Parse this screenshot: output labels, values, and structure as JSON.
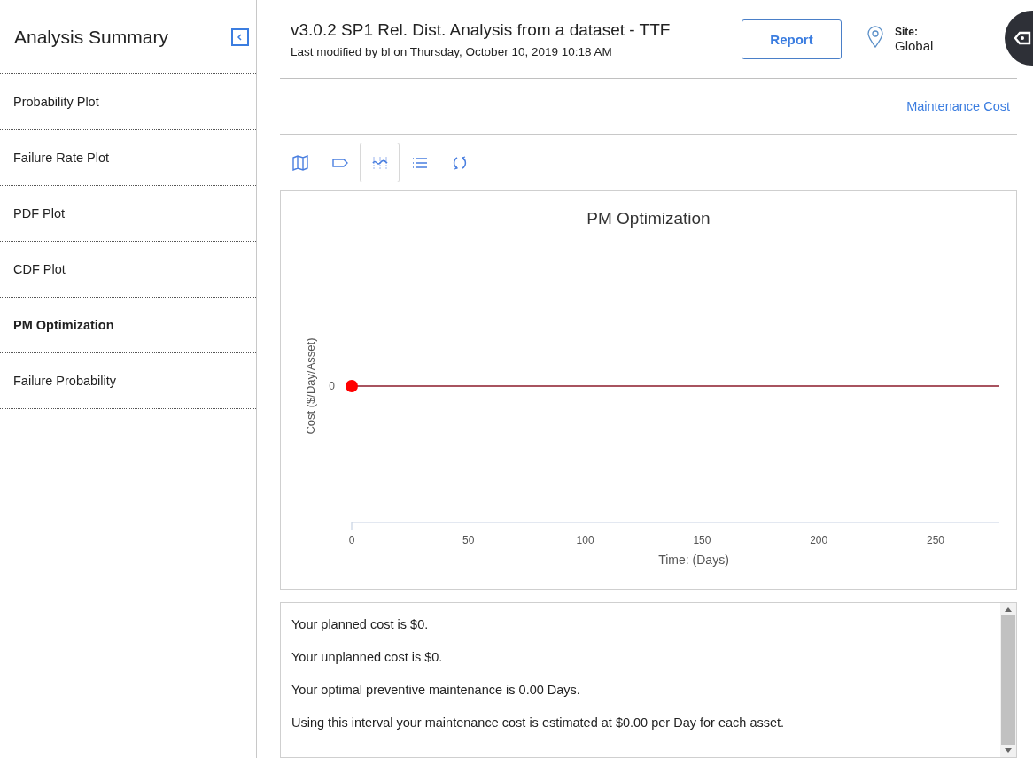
{
  "sidebar": {
    "title": "Analysis Summary",
    "items": [
      {
        "label": "Probability Plot",
        "selected": false
      },
      {
        "label": "Failure Rate Plot",
        "selected": false
      },
      {
        "label": "PDF Plot",
        "selected": false
      },
      {
        "label": "CDF Plot",
        "selected": false
      },
      {
        "label": "PM Optimization",
        "selected": true
      },
      {
        "label": "Failure Probability",
        "selected": false
      }
    ]
  },
  "header": {
    "title": "v3.0.2 SP1 Rel. Dist. Analysis from a dataset - TTF",
    "subtitle": "Last modified by bl on Thursday, October 10, 2019 10:18 AM",
    "report_button": "Report",
    "site_label": "Site:",
    "site_value": "Global"
  },
  "link": "Maintenance Cost",
  "toolbar": [
    {
      "kind": "map",
      "selected": false
    },
    {
      "kind": "tag",
      "selected": false
    },
    {
      "kind": "chart",
      "selected": true
    },
    {
      "kind": "list",
      "selected": false
    },
    {
      "kind": "refresh",
      "selected": false
    }
  ],
  "chart": {
    "title": "PM Optimization",
    "xlabel": "Time: (Days)",
    "ylabel": "Cost ($/Day/Asset)",
    "y_tick_labels": [
      "0"
    ],
    "x_tick_labels": [
      "0",
      "50",
      "100",
      "150",
      "200",
      "250"
    ]
  },
  "summary": [
    "Your planned cost is $0.",
    "Your unplanned cost is $0.",
    "Your optimal preventive maintenance is 0.00 Days.",
    "Using this interval your maintenance cost is estimated at $0.00 per Day for each asset."
  ]
}
